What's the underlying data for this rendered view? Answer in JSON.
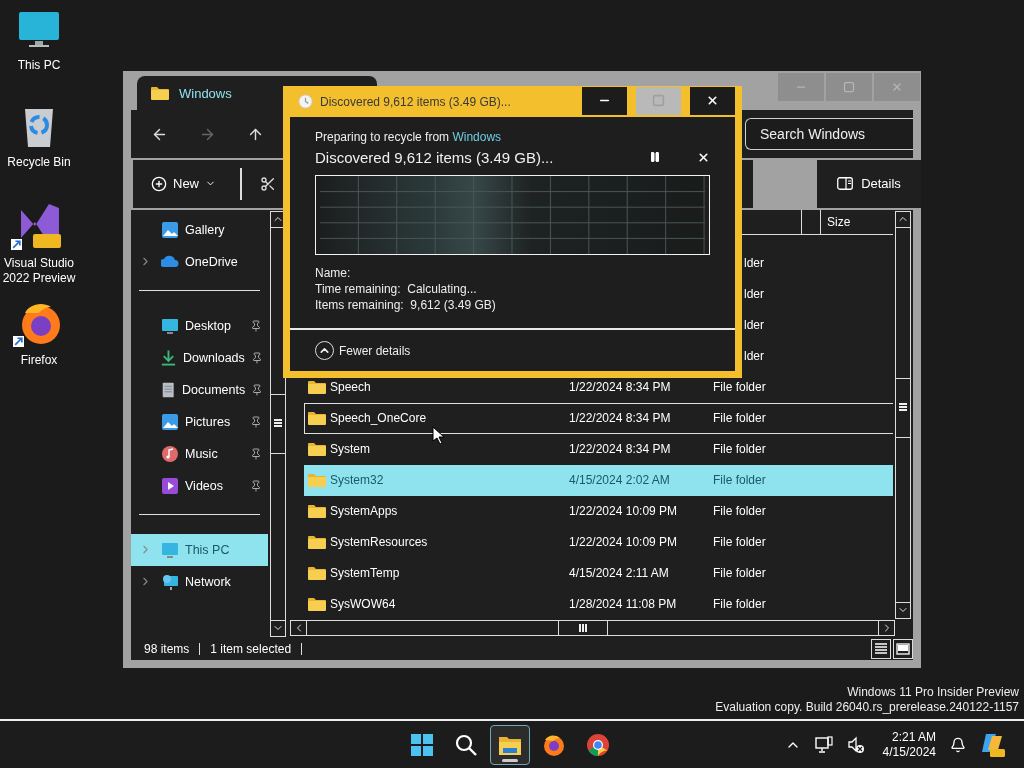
{
  "desktop_icons": [
    {
      "kind": "monitor",
      "label": "This PC",
      "shortcut": false
    },
    {
      "kind": "recycle",
      "label": "Recycle Bin",
      "shortcut": false
    },
    {
      "kind": "studio",
      "label": "Visual Studio 2022 Preview",
      "shortcut": true
    },
    {
      "kind": "firefox",
      "label": "Firefox",
      "shortcut": true
    }
  ],
  "explorer": {
    "tab": {
      "title": "Windows"
    },
    "window_buttons": [
      {
        "kind": "minimize"
      },
      {
        "kind": "maximize"
      },
      {
        "kind": "close"
      }
    ],
    "nav_buttons": [
      {
        "kind": "back",
        "disabled": false
      },
      {
        "kind": "forward",
        "disabled": true
      },
      {
        "kind": "up",
        "disabled": false
      }
    ],
    "search": {
      "placeholder": "Search Windows"
    },
    "command_bar": {
      "new_label": "New",
      "details_label": "Details"
    },
    "sidebar": {
      "sections": [
        {
          "items": [
            {
              "kind": "gallery",
              "label": "Gallery",
              "expandable": false,
              "pinned": false,
              "selected": false
            },
            {
              "kind": "cloud",
              "label": "OneDrive",
              "expandable": true,
              "pinned": false,
              "selected": false
            }
          ]
        },
        {
          "items": [
            {
              "kind": "desktop",
              "label": "Desktop",
              "expandable": false,
              "pinned": true,
              "selected": false
            },
            {
              "kind": "downloads",
              "label": "Downloads",
              "expandable": false,
              "pinned": true,
              "selected": false
            },
            {
              "kind": "documents",
              "label": "Documents",
              "expandable": false,
              "pinned": true,
              "selected": false
            },
            {
              "kind": "pictures",
              "label": "Pictures",
              "expandable": false,
              "pinned": true,
              "selected": false
            },
            {
              "kind": "music",
              "label": "Music",
              "expandable": false,
              "pinned": true,
              "selected": false
            },
            {
              "kind": "videos",
              "label": "Videos",
              "expandable": false,
              "pinned": true,
              "selected": false
            }
          ]
        },
        {
          "items": [
            {
              "kind": "pc",
              "label": "This PC",
              "expandable": true,
              "pinned": false,
              "selected": true
            },
            {
              "kind": "network",
              "label": "Network",
              "expandable": true,
              "pinned": false,
              "selected": false
            }
          ]
        }
      ]
    },
    "file_list": {
      "columns": [
        {
          "label": "Size"
        }
      ],
      "rows": [
        {
          "kind": "covered",
          "type": "lder",
          "selected": false,
          "hovered": false
        },
        {
          "kind": "covered",
          "type": "lder",
          "selected": false,
          "hovered": false
        },
        {
          "kind": "covered",
          "type": "lder",
          "selected": false,
          "hovered": false
        },
        {
          "kind": "covered",
          "type": "lder",
          "selected": false,
          "hovered": false
        },
        {
          "kind": "full",
          "name": "Speech",
          "date": "1/22/2024 8:34 PM",
          "type": "File folder",
          "selected": false,
          "hovered": false
        },
        {
          "kind": "full",
          "name": "Speech_OneCore",
          "date": "1/22/2024 8:34 PM",
          "type": "File folder",
          "selected": false,
          "hovered": true
        },
        {
          "kind": "full",
          "name": "System",
          "date": "1/22/2024 8:34 PM",
          "type": "File folder",
          "selected": false,
          "hovered": false
        },
        {
          "kind": "full",
          "name": "System32",
          "date": "4/15/2024 2:02 AM",
          "type": "File folder",
          "selected": true,
          "hovered": false
        },
        {
          "kind": "full",
          "name": "SystemApps",
          "date": "1/22/2024 10:09 PM",
          "type": "File folder",
          "selected": false,
          "hovered": false
        },
        {
          "kind": "full",
          "name": "SystemResources",
          "date": "1/22/2024 10:09 PM",
          "type": "File folder",
          "selected": false,
          "hovered": false
        },
        {
          "kind": "full",
          "name": "SystemTemp",
          "date": "4/15/2024 2:11 AM",
          "type": "File folder",
          "selected": false,
          "hovered": false
        },
        {
          "kind": "full",
          "name": "SysWOW64",
          "date": "1/28/2024 11:08 PM",
          "type": "File folder",
          "selected": false,
          "hovered": false
        }
      ]
    },
    "status_bar": {
      "item_count": "98 items",
      "selection": "1 item selected"
    }
  },
  "dialog": {
    "title": "Discovered 9,612 items (3.49 GB)...",
    "window_buttons": [
      {
        "kind": "minimize",
        "disabled": false
      },
      {
        "kind": "maximize",
        "disabled": true
      },
      {
        "kind": "close",
        "disabled": false
      }
    ],
    "source_prefix": "Preparing to recycle from ",
    "source_link": "Windows",
    "heading": "Discovered 9,612 items (3.49 GB)...",
    "details": [
      {
        "label": "Name:"
      },
      {
        "label": "Time remaining:",
        "value": "Calculating..."
      },
      {
        "label": "Items remaining:",
        "value": "9,612 (3.49 GB)"
      }
    ],
    "toggle": "Fewer details"
  },
  "watermark": [
    "Windows 11 Pro Insider Preview",
    "Evaluation copy. Build 26040.rs_prerelease.240122-1157"
  ],
  "taskbar": {
    "apps": [
      {
        "kind": "start",
        "active": false
      },
      {
        "kind": "search",
        "active": false
      },
      {
        "kind": "explorer",
        "active": true
      },
      {
        "kind": "firefox",
        "active": false
      },
      {
        "kind": "chrome",
        "active": false
      }
    ],
    "time": "2:21 AM",
    "date": "4/15/2024"
  }
}
